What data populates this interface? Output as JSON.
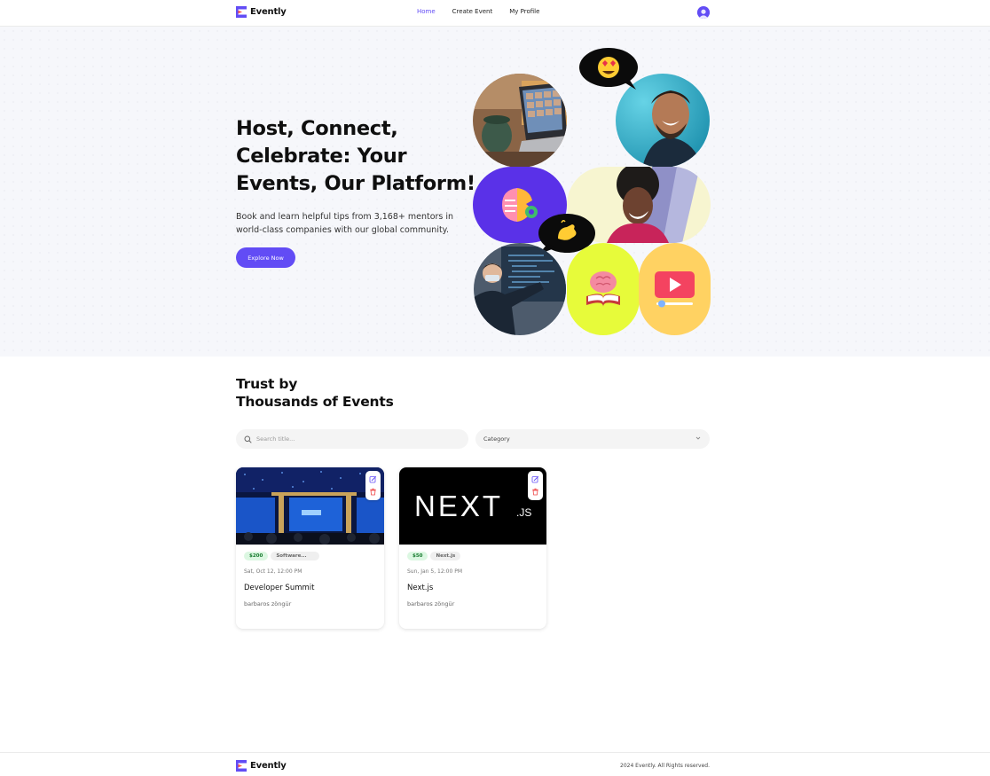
{
  "brand": {
    "name": "Evently"
  },
  "nav": {
    "home": "Home",
    "create_event": "Create Event",
    "my_profile": "My Profile"
  },
  "hero": {
    "title": "Host, Connect, Celebrate: Your Events, Our Platform!",
    "subtitle": "Book and learn helpful tips from 3,168+ mentors in world-class companies with our global community.",
    "cta": "Explore Now"
  },
  "trust": {
    "title_line1": "Trust by",
    "title_line2": "Thousands of Events",
    "search_placeholder": "Search title...",
    "category_label": "Category"
  },
  "events": [
    {
      "price": "$200",
      "category": "Software...",
      "date": "Sat, Oct 12, 12:00 PM",
      "title": "Developer Summit",
      "organizer": "barbaros zöngür"
    },
    {
      "price": "$50",
      "category": "Next.js",
      "date": "Sun, Jan 5, 12:00 PM",
      "title": "Next.js",
      "organizer": "barbaros zöngür",
      "image_text": "NEXT",
      "image_suffix": ".JS"
    }
  ],
  "footer": {
    "copyright": "2024 Evently. All Rights reserved."
  },
  "colors": {
    "accent": "#624cf5",
    "hero_bg": "#f6f7fb",
    "price_badge_bg": "#dcf7e2",
    "price_badge_text": "#167a2e"
  },
  "icons": [
    "search-icon",
    "chevron-down-icon",
    "edit-icon",
    "delete-icon",
    "user-avatar-icon",
    "brain-icon",
    "book-icon",
    "play-icon",
    "heart-eyes-emoji-icon",
    "waving-hand-emoji-icon"
  ]
}
